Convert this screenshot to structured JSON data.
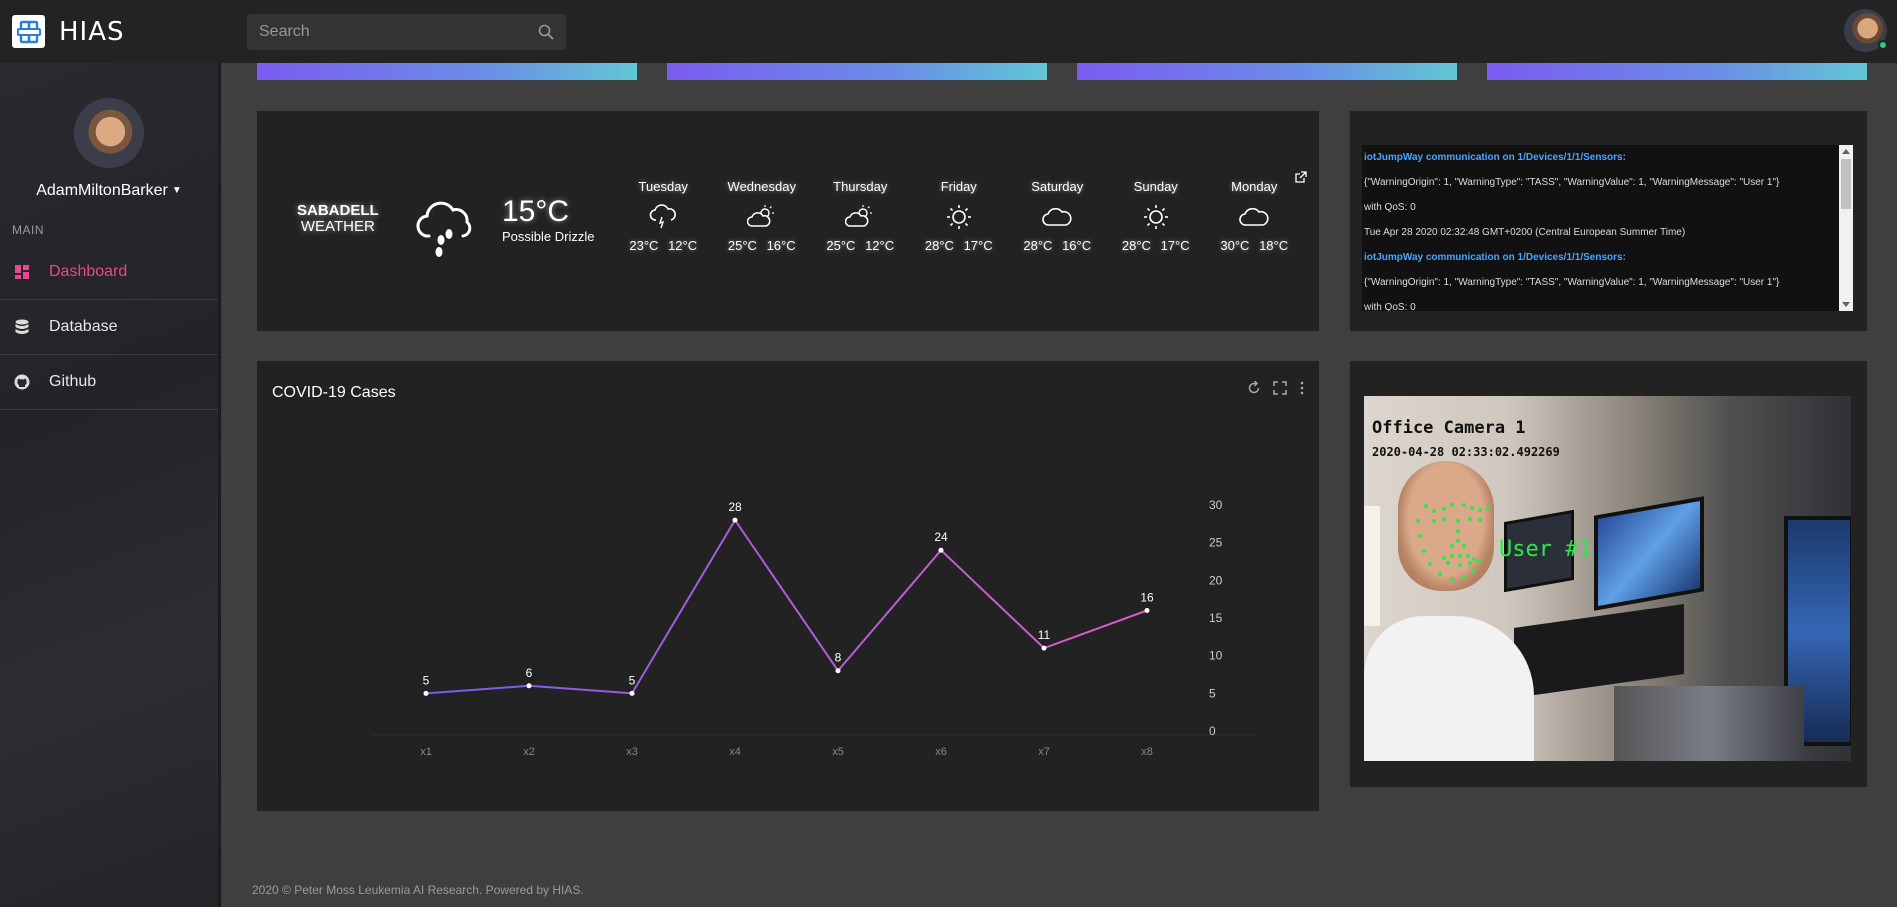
{
  "app": {
    "name": "HIAS"
  },
  "search": {
    "placeholder": "Search"
  },
  "user": {
    "name": "AdamMiltonBarker"
  },
  "sidebar": {
    "section": "MAIN",
    "items": [
      {
        "label": "Dashboard",
        "icon": "dashboard-icon",
        "active": true
      },
      {
        "label": "Database",
        "icon": "database-icon",
        "active": false
      },
      {
        "label": "Github",
        "icon": "github-icon",
        "active": false
      }
    ]
  },
  "weather": {
    "city": "SABADELL",
    "subtitle": "WEATHER",
    "current_temp": "15°C",
    "current_desc": "Possible Drizzle",
    "current_icon": "rain-cloud-icon",
    "days": [
      {
        "name": "Tuesday",
        "icon": "drizzle-icon",
        "high": "23°C",
        "low": "12°C"
      },
      {
        "name": "Wednesday",
        "icon": "partly-cloudy-icon",
        "high": "25°C",
        "low": "16°C"
      },
      {
        "name": "Thursday",
        "icon": "partly-cloudy-icon",
        "high": "25°C",
        "low": "12°C"
      },
      {
        "name": "Friday",
        "icon": "sun-icon",
        "high": "28°C",
        "low": "17°C"
      },
      {
        "name": "Saturday",
        "icon": "cloud-icon",
        "high": "28°C",
        "low": "16°C"
      },
      {
        "name": "Sunday",
        "icon": "sun-icon",
        "high": "28°C",
        "low": "17°C"
      },
      {
        "name": "Monday",
        "icon": "cloud-icon",
        "high": "30°C",
        "low": "18°C"
      }
    ]
  },
  "feed": {
    "lines": [
      {
        "text": "iotJumpWay communication on 1/Devices/1/1/Sensors:",
        "head": true
      },
      {
        "text": "{\"WarningOrigin\": 1, \"WarningType\": \"TASS\", \"WarningValue\": 1, \"WarningMessage\": \"User 1\"}",
        "head": false
      },
      {
        "text": "with QoS: 0",
        "head": false
      },
      {
        "text": "Tue Apr 28 2020 02:32:48 GMT+0200 (Central European Summer Time)",
        "head": false
      },
      {
        "text": "iotJumpWay communication on 1/Devices/1/1/Sensors:",
        "head": true
      },
      {
        "text": "{\"WarningOrigin\": 1, \"WarningType\": \"TASS\", \"WarningValue\": 1, \"WarningMessage\": \"User 1\"}",
        "head": false
      },
      {
        "text": "with QoS: 0",
        "head": false
      }
    ]
  },
  "chart": {
    "title": "COVID-19 Cases"
  },
  "chart_data": {
    "type": "line",
    "title": "COVID-19 Cases",
    "categories": [
      "x1",
      "x2",
      "x3",
      "x4",
      "x5",
      "x6",
      "x7",
      "x8"
    ],
    "values": [
      5,
      6,
      5,
      28,
      8,
      24,
      11,
      16
    ],
    "yticks": [
      "0",
      "5",
      "10",
      "15",
      "20",
      "25",
      "30"
    ],
    "ylim": [
      0,
      30
    ],
    "y_axis_side": "right",
    "grid": false,
    "line_gradient": [
      "#7a5cf0",
      "#e25cc8"
    ],
    "data_labels": true
  },
  "camera": {
    "title": "Office Camera 1",
    "timestamp": "2020-04-28 02:33:02.492269",
    "user_tag": "User #1"
  },
  "footer": {
    "text": "2020 © Peter Moss Leukemia AI Research. Powered by HIAS."
  },
  "colors": {
    "accent": "#e9478f",
    "link": "#4aa3ff",
    "card": "#222222"
  }
}
